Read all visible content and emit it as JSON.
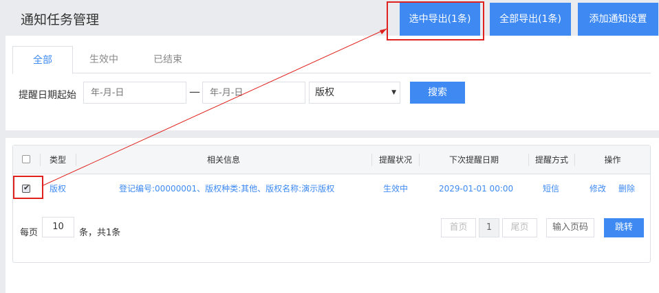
{
  "header": {
    "title": "通知任务管理",
    "export_selected_label": "选中导出(1条)",
    "export_all_label": "全部导出(1条)",
    "add_label": "添加通知设置"
  },
  "tabs": [
    {
      "label": "全部",
      "active": true
    },
    {
      "label": "生效中",
      "active": false
    },
    {
      "label": "已结束",
      "active": false
    }
  ],
  "filter": {
    "label": "提醒日期起始",
    "start_placeholder": "年-月-日",
    "separator": "—",
    "end_placeholder": "年-月-日",
    "type_value": "版权",
    "search_label": "搜索"
  },
  "table": {
    "headers": [
      "类型",
      "相关信息",
      "提醒状况",
      "下次提醒日期",
      "提醒方式",
      "操作"
    ],
    "rows": [
      {
        "checked": true,
        "type": "版权",
        "info": "登记编号:00000001、版权种类:其他、版权名称:演示版权",
        "status": "生效中",
        "next_date": "2029-01-01 00:00",
        "method": "短信",
        "edit": "修改",
        "delete": "删除"
      }
    ]
  },
  "pagination": {
    "per_page_label": "每页",
    "per_page": "10",
    "total_label": "条，共1条",
    "first": "首页",
    "current": "1",
    "last": "尾页",
    "page_input_placeholder": "输入页码",
    "jump_label": "跳转"
  },
  "colors": {
    "accent": "#3e8af2",
    "annotation": "#e0201c"
  }
}
